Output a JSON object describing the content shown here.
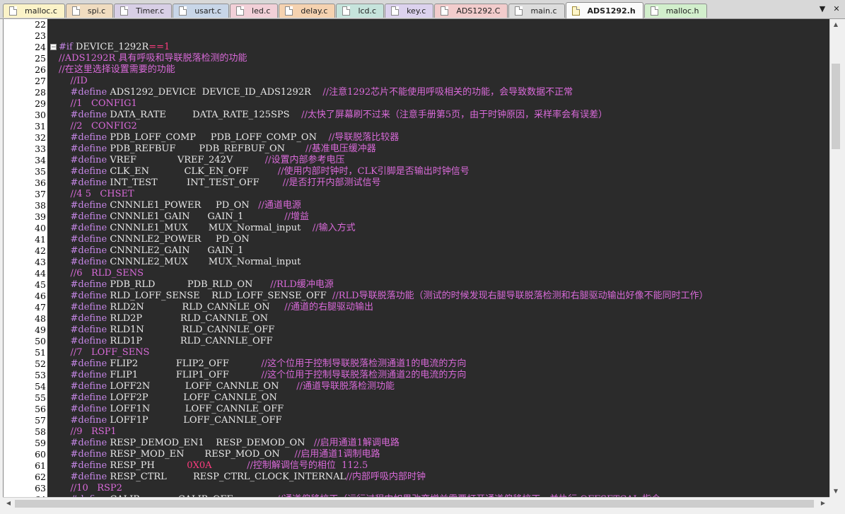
{
  "tabs": [
    {
      "label": "malloc.c",
      "color": "#fbf3c8"
    },
    {
      "label": "spi.c",
      "color": "#f0dcc0"
    },
    {
      "label": "Timer.c",
      "color": "#d8cfe6"
    },
    {
      "label": "usart.c",
      "color": "#c8d6e8"
    },
    {
      "label": "led.c",
      "color": "#f2d0d8"
    },
    {
      "label": "delay.c",
      "color": "#f5d2b0"
    },
    {
      "label": "lcd.c",
      "color": "#c6e4dc"
    },
    {
      "label": "key.c",
      "color": "#dcd2ee"
    },
    {
      "label": "ADS1292.C",
      "color": "#f2cccc"
    },
    {
      "label": "main.c",
      "color": "#dddddd"
    },
    {
      "label": "ADS1292.h",
      "color": "#fbfbfb",
      "active": true
    },
    {
      "label": "malloc.h",
      "color": "#d2efcc"
    }
  ],
  "tab_controls": {
    "dropdown": "▼",
    "close": "✕"
  },
  "colors": {
    "keyword": "#c586e6",
    "identifier": "#e8e8e8",
    "comment": "#d96ad9",
    "number": "#ff3b7f",
    "background": "#2b2b2b"
  },
  "code_lines": [
    {
      "n": "22",
      "segs": []
    },
    {
      "n": "23",
      "segs": []
    },
    {
      "n": "24",
      "fold": "−",
      "segs": [
        [
          "kw",
          "#if "
        ],
        [
          "id",
          "DEVICE_1292R"
        ],
        [
          "num",
          "==1"
        ]
      ]
    },
    {
      "n": "25",
      "segs": [
        [
          "cm",
          "//ADS1292R 具有呼吸和导联脱落检测的功能"
        ]
      ]
    },
    {
      "n": "26",
      "segs": [
        [
          "cm",
          "//在这里选择设置需要的功能"
        ]
      ]
    },
    {
      "n": "27",
      "segs": [
        [
          "cm",
          "    //ID"
        ]
      ]
    },
    {
      "n": "28",
      "segs": [
        [
          "kw",
          "    #define "
        ],
        [
          "id",
          "ADS1292_DEVICE  DEVICE_ID_ADS1292R    "
        ],
        [
          "cm",
          "//注意1292芯片不能使用呼吸相关的功能，会导致数据不正常"
        ]
      ]
    },
    {
      "n": "29",
      "segs": [
        [
          "cm",
          "    //1   CONFIG1"
        ]
      ]
    },
    {
      "n": "30",
      "segs": [
        [
          "kw",
          "    #define "
        ],
        [
          "id",
          "DATA_RATE         DATA_RATE_125SPS    "
        ],
        [
          "cm",
          "//太快了屏幕刷不过来（注意手册第5页，由于时钟原因，采样率会有误差）"
        ]
      ]
    },
    {
      "n": "31",
      "segs": [
        [
          "cm",
          "    //2   CONFIG2"
        ]
      ]
    },
    {
      "n": "32",
      "segs": [
        [
          "kw",
          "    #define "
        ],
        [
          "id",
          "PDB_LOFF_COMP     PDB_LOFF_COMP_ON    "
        ],
        [
          "cm",
          "//导联脱落比较器"
        ]
      ]
    },
    {
      "n": "33",
      "segs": [
        [
          "kw",
          "    #define "
        ],
        [
          "id",
          "PDB_REFBUF        PDB_REFBUF_ON       "
        ],
        [
          "cm",
          "//基准电压缓冲器"
        ]
      ]
    },
    {
      "n": "34",
      "segs": [
        [
          "kw",
          "    #define "
        ],
        [
          "id",
          "VREF              VREF_242V           "
        ],
        [
          "cm",
          "//设置内部参考电压"
        ]
      ]
    },
    {
      "n": "35",
      "segs": [
        [
          "kw",
          "    #define "
        ],
        [
          "id",
          "CLK_EN            CLK_EN_OFF          "
        ],
        [
          "cm",
          "//使用内部时钟时，CLK引脚是否输出时钟信号"
        ]
      ]
    },
    {
      "n": "36",
      "segs": [
        [
          "kw",
          "    #define "
        ],
        [
          "id",
          "INT_TEST          INT_TEST_OFF        "
        ],
        [
          "cm",
          "//是否打开内部测试信号"
        ]
      ]
    },
    {
      "n": "37",
      "segs": [
        [
          "cm",
          "    //4 5   CHSET"
        ]
      ]
    },
    {
      "n": "38",
      "segs": [
        [
          "kw",
          "    #define "
        ],
        [
          "id",
          "CNNNLE1_POWER     PD_ON   "
        ],
        [
          "cm",
          "//通道电源"
        ]
      ]
    },
    {
      "n": "39",
      "segs": [
        [
          "kw",
          "    #define "
        ],
        [
          "id",
          "CNNNLE1_GAIN      GAIN_1              "
        ],
        [
          "cm",
          "//增益"
        ]
      ]
    },
    {
      "n": "40",
      "segs": [
        [
          "kw",
          "    #define "
        ],
        [
          "id",
          "CNNNLE1_MUX       MUX_Normal_input    "
        ],
        [
          "cm",
          "//输入方式"
        ]
      ]
    },
    {
      "n": "41",
      "segs": [
        [
          "kw",
          "    #define "
        ],
        [
          "id",
          "CNNNLE2_POWER     PD_ON"
        ]
      ]
    },
    {
      "n": "42",
      "segs": [
        [
          "kw",
          "    #define "
        ],
        [
          "id",
          "CNNNLE2_GAIN      GAIN_1"
        ]
      ]
    },
    {
      "n": "43",
      "segs": [
        [
          "kw",
          "    #define "
        ],
        [
          "id",
          "CNNNLE2_MUX       MUX_Normal_input"
        ]
      ]
    },
    {
      "n": "44",
      "segs": [
        [
          "cm",
          "    //6   RLD_SENS"
        ]
      ]
    },
    {
      "n": "45",
      "segs": [
        [
          "kw",
          "    #define "
        ],
        [
          "id",
          "PDB_RLD           PDB_RLD_ON      "
        ],
        [
          "cm",
          "//RLD缓冲电源"
        ]
      ]
    },
    {
      "n": "46",
      "segs": [
        [
          "kw",
          "    #define "
        ],
        [
          "id",
          "RLD_LOFF_SENSE    RLD_LOFF_SENSE_OFF  "
        ],
        [
          "cm",
          "//RLD导联脱落功能（测试的时候发现右腿导联脱落检测和右腿驱动输出好像不能同时工作）"
        ]
      ]
    },
    {
      "n": "47",
      "segs": [
        [
          "kw",
          "    #define "
        ],
        [
          "id",
          "RLD2N             RLD_CANNLE_ON     "
        ],
        [
          "cm",
          "//通道的右腿驱动输出"
        ]
      ]
    },
    {
      "n": "48",
      "segs": [
        [
          "kw",
          "    #define "
        ],
        [
          "id",
          "RLD2P             RLD_CANNLE_ON"
        ]
      ]
    },
    {
      "n": "49",
      "segs": [
        [
          "kw",
          "    #define "
        ],
        [
          "id",
          "RLD1N             RLD_CANNLE_OFF"
        ]
      ]
    },
    {
      "n": "50",
      "segs": [
        [
          "kw",
          "    #define "
        ],
        [
          "id",
          "RLD1P             RLD_CANNLE_OFF"
        ]
      ]
    },
    {
      "n": "51",
      "segs": [
        [
          "cm",
          "    //7   LOFF_SENS"
        ]
      ]
    },
    {
      "n": "52",
      "segs": [
        [
          "kw",
          "    #define "
        ],
        [
          "id",
          "FLIP2             FLIP2_OFF           "
        ],
        [
          "cm",
          "//这个位用于控制导联脱落检测通道1的电流的方向"
        ]
      ]
    },
    {
      "n": "53",
      "segs": [
        [
          "kw",
          "    #define "
        ],
        [
          "id",
          "FLIP1             FLIP1_OFF           "
        ],
        [
          "cm",
          "//这个位用于控制导联脱落检测通道2的电流的方向"
        ]
      ]
    },
    {
      "n": "54",
      "segs": [
        [
          "kw",
          "    #define "
        ],
        [
          "id",
          "LOFF2N            LOFF_CANNLE_ON      "
        ],
        [
          "cm",
          "//通道导联脱落检测功能"
        ]
      ]
    },
    {
      "n": "55",
      "segs": [
        [
          "kw",
          "    #define "
        ],
        [
          "id",
          "LOFF2P            LOFF_CANNLE_ON"
        ]
      ]
    },
    {
      "n": "56",
      "segs": [
        [
          "kw",
          "    #define "
        ],
        [
          "id",
          "LOFF1N            LOFF_CANNLE_OFF"
        ]
      ]
    },
    {
      "n": "57",
      "segs": [
        [
          "kw",
          "    #define "
        ],
        [
          "id",
          "LOFF1P            LOFF_CANNLE_OFF"
        ]
      ]
    },
    {
      "n": "58",
      "segs": [
        [
          "cm",
          "    //9   RSP1"
        ]
      ]
    },
    {
      "n": "59",
      "segs": [
        [
          "kw",
          "    #define "
        ],
        [
          "id",
          "RESP_DEMOD_EN1    RESP_DEMOD_ON   "
        ],
        [
          "cm",
          "//启用通道1解调电路"
        ]
      ]
    },
    {
      "n": "60",
      "segs": [
        [
          "kw",
          "    #define "
        ],
        [
          "id",
          "RESP_MOD_EN       RESP_MOD_ON     "
        ],
        [
          "cm",
          "//启用通道1调制电路"
        ]
      ]
    },
    {
      "n": "61",
      "segs": [
        [
          "kw",
          "    #define "
        ],
        [
          "id",
          "RESP_PH           "
        ],
        [
          "num",
          "0X0A            "
        ],
        [
          "cm",
          "//控制解调信号的相位  112.5"
        ]
      ]
    },
    {
      "n": "62",
      "segs": [
        [
          "kw",
          "    #define "
        ],
        [
          "id",
          "RESP_CTRL         RESP_CTRL_CLOCK_INTERNAL"
        ],
        [
          "cm",
          "//内部呼吸内部时钟"
        ]
      ]
    },
    {
      "n": "63",
      "segs": [
        [
          "cm",
          "    //10   RSP2"
        ]
      ]
    },
    {
      "n": "64",
      "segs": [
        [
          "kw",
          "    #define "
        ],
        [
          "id",
          "CALIB             CALIB_OFF               "
        ],
        [
          "cm",
          "//通道偏移校正（运行过程中如果改变增益需要打开通道偏移校正，并执行 OFFSETCAL 指令"
        ]
      ]
    }
  ]
}
